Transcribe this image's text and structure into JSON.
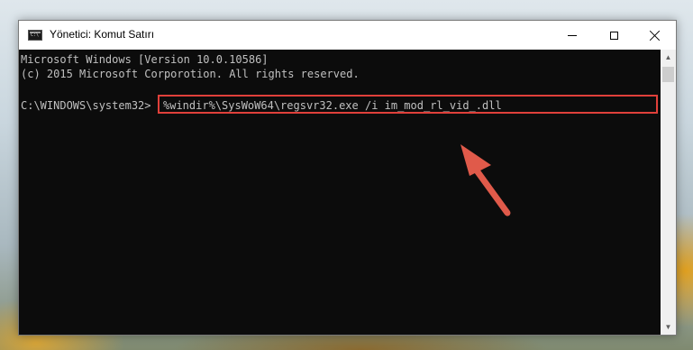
{
  "window": {
    "title": "Yönetici: Komut Satırı",
    "icon": "console-icon"
  },
  "controls": {
    "minimize": "minimize",
    "maximize": "maximize",
    "close": "close"
  },
  "console": {
    "line1": "Microsoft Windows [Version 10.0.10586]",
    "line2": "(c) 2015 Microsoft Corporotion. All rights reserved.",
    "prompt": "C:\\WINDOWS\\system32>",
    "command": "%windir%\\SysWoW64\\regsvr32.exe /i im_mod_rl_vid_.dll"
  },
  "annotation": {
    "highlight_color": "#e0403a",
    "arrow_color": "#e05a4a"
  }
}
